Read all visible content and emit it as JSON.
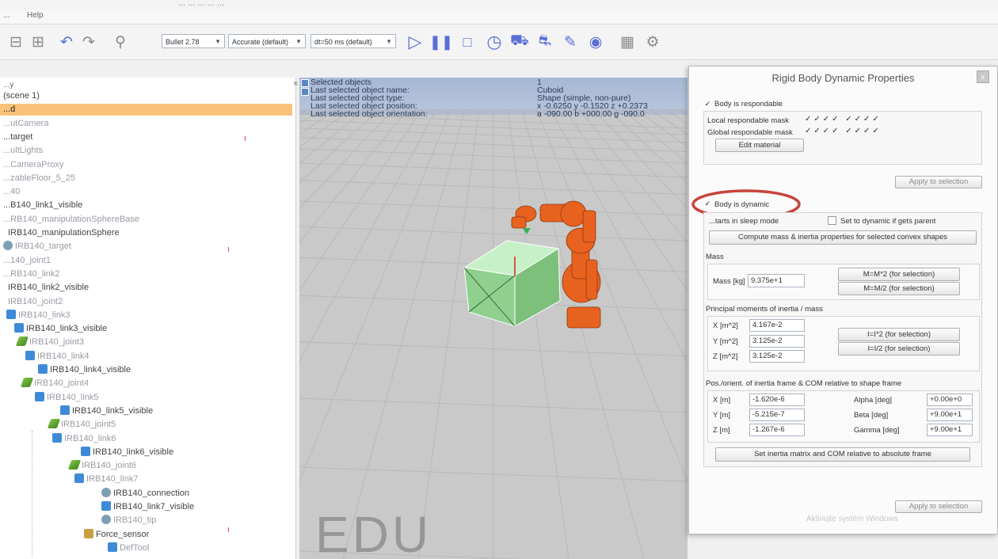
{
  "window": {
    "title": "...  ...  ...  ...  ...",
    "menu": [
      "...",
      "Help"
    ]
  },
  "toolbar": {
    "engine_select": "Bullet 2.78",
    "accuracy_select": "Accurate (default)",
    "timestep_select": "dt=50 ms (default)"
  },
  "hierarchy": {
    "header": "...y",
    "items": [
      {
        "label": "(scene 1)",
        "indent": 0,
        "style": "normal",
        "icon": ""
      },
      {
        "label": "...d",
        "indent": 0,
        "style": "sel",
        "icon": ""
      },
      {
        "label": "...utCamera",
        "indent": 0,
        "style": "dim",
        "icon": ""
      },
      {
        "label": "...target",
        "indent": 0,
        "style": "normal",
        "icon": ""
      },
      {
        "label": "...ultLights",
        "indent": 0,
        "style": "dim",
        "icon": ""
      },
      {
        "label": "...CameraProxy",
        "indent": 0,
        "style": "dim",
        "icon": ""
      },
      {
        "label": "...zableFloor_5_25",
        "indent": 0,
        "style": "dim",
        "icon": ""
      },
      {
        "label": "...40",
        "indent": 0,
        "style": "dim",
        "icon": ""
      },
      {
        "label": "...B140_link1_visible",
        "indent": 0,
        "style": "normal",
        "icon": ""
      },
      {
        "label": "...RB140_manipulationSphereBase",
        "indent": 0,
        "style": "dim",
        "icon": ""
      },
      {
        "label": "IRB140_manipulationSphere",
        "indent": 6,
        "style": "normal",
        "icon": ""
      },
      {
        "label": "IRB140_target",
        "indent": 0,
        "style": "dim",
        "icon": "dummy"
      },
      {
        "label": "...140_joint1",
        "indent": 0,
        "style": "dim",
        "icon": ""
      },
      {
        "label": "...RB140_link2",
        "indent": 0,
        "style": "dim",
        "icon": ""
      },
      {
        "label": "IRB140_link2_visible",
        "indent": 6,
        "style": "normal",
        "icon": ""
      },
      {
        "label": "IRB140_joint2",
        "indent": 6,
        "style": "dim",
        "icon": ""
      },
      {
        "label": "IRB140_link3",
        "indent": 4,
        "style": "dim",
        "icon": "shape"
      },
      {
        "label": "IRB140_link3_visible",
        "indent": 14,
        "style": "normal",
        "icon": "shape"
      },
      {
        "label": "IRB140_joint3",
        "indent": 18,
        "style": "dim",
        "icon": "joint"
      },
      {
        "label": "IRB140_link4",
        "indent": 28,
        "style": "dim",
        "icon": "shape"
      },
      {
        "label": "IRB140_link4_visible",
        "indent": 44,
        "style": "normal",
        "icon": "shape"
      },
      {
        "label": "IRB140_joint4",
        "indent": 24,
        "style": "dim",
        "icon": "joint"
      },
      {
        "label": "IRB140_link5",
        "indent": 40,
        "style": "dim",
        "icon": "shape"
      },
      {
        "label": "IRB140_link5_visible",
        "indent": 72,
        "style": "normal",
        "icon": "shape"
      },
      {
        "label": "IRB140_joint5",
        "indent": 58,
        "style": "dim",
        "icon": "joint"
      },
      {
        "label": "IRB140_link6",
        "indent": 62,
        "style": "dim",
        "icon": "shape"
      },
      {
        "label": "IRB140_link6_visible",
        "indent": 98,
        "style": "normal",
        "icon": "shape"
      },
      {
        "label": "IRB140_joint6",
        "indent": 84,
        "style": "dim",
        "icon": "joint"
      },
      {
        "label": "IRB140_link7",
        "indent": 90,
        "style": "dim",
        "icon": "shape"
      },
      {
        "label": "IRB140_connection",
        "indent": 124,
        "style": "normal",
        "icon": "dummy"
      },
      {
        "label": "IRB140_link7_visible",
        "indent": 124,
        "style": "normal",
        "icon": "shape"
      },
      {
        "label": "IRB140_tip",
        "indent": 124,
        "style": "dim",
        "icon": "dummy"
      },
      {
        "label": "Force_sensor",
        "indent": 102,
        "style": "normal",
        "icon": "cam"
      },
      {
        "label": "DefTool",
        "indent": 132,
        "style": "dim",
        "icon": "shape"
      }
    ]
  },
  "viewport": {
    "info_labels": [
      "Selected objects",
      "Last selected object name:",
      "Last selected object type:",
      "Last selected object position:",
      "Last selected object orientation:"
    ],
    "info_values": [
      "1",
      "Cuboid",
      "Shape (simple, non-pure)",
      "x -0.6250   y -0.1520   z +0.2373",
      "a -090.00   b +000.00   g -090.0"
    ],
    "watermark": "EDU"
  },
  "dialog": {
    "title": "Rigid Body Dynamic Properties",
    "close": "x",
    "respondable_label": "Body is respondable",
    "local_mask_label": "Local respondable mask",
    "global_mask_label": "Global respondable mask",
    "mask_pattern": "✓✓✓✓ ✓✓✓✓",
    "edit_material": "Edit material",
    "apply_top": "Apply to selection",
    "dynamic_label": "Body is dynamic",
    "static_label": "...tarts in sleep mode",
    "dynamic_parent_label": "Set to dynamic if gets parent",
    "compute_btn": "Compute mass & inertia properties for selected convex shapes",
    "mass_group": "Mass",
    "mass_label": "Mass [kg]",
    "mass_value": "9.375e+1",
    "mass_x2": "M=M*2  (for selection)",
    "mass_half": "M=M/2  (for selection)",
    "inertia_group": "Principal moments of inertia / mass",
    "inertia_labels": [
      "X [m^2]",
      "Y [m^2]",
      "Z [m^2]"
    ],
    "inertia_values": [
      "4.167e-2",
      "3.125e-2",
      "3.125e-2"
    ],
    "inertia_x2": "I=I*2  (for selection)",
    "inertia_half": "I=I/2  (for selection)",
    "pos_group": "Pos./orient. of inertia frame & COM relative to shape frame",
    "pos_labels": [
      "X [m]",
      "Y [m]",
      "Z [m]"
    ],
    "pos_values": [
      "-1.620e-6",
      "-5.215e-7",
      "-1.267e-6"
    ],
    "ang_labels": [
      "Alpha [deg]",
      "Beta [deg]",
      "Gamma [deg]"
    ],
    "ang_values": [
      "+0.00e+0",
      "+9.00e+1",
      "+9.00e+1"
    ],
    "set_frame_btn": "Set inertia matrix and COM relative to absolute frame",
    "apply_bottom": "Apply to selection",
    "activate_watermark": "Aktivujte systém Windows"
  },
  "colors": {
    "selection": "#f8c27a",
    "cube": "#9ee0a0",
    "robot": "#e8621f",
    "highlight_ring": "#c8443c"
  }
}
